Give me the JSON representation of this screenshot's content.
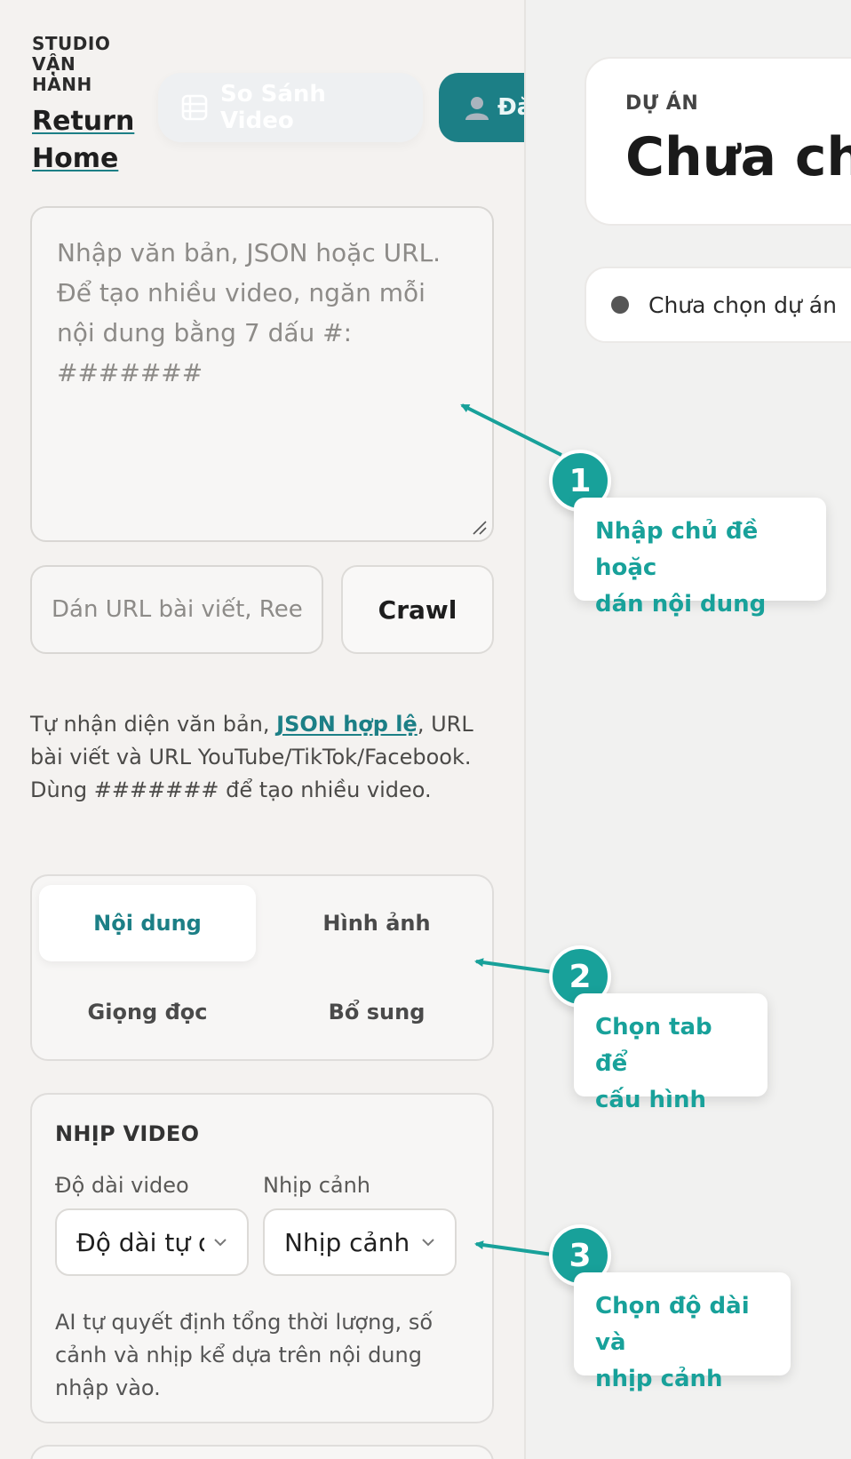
{
  "brand": {
    "title_lines": [
      "STUDIO",
      "VẬN",
      "HÀNH"
    ],
    "return_home": "Return Home"
  },
  "header": {
    "compare_label": "So Sánh Video",
    "teal_button_label": "Đă"
  },
  "input": {
    "placeholder_lines": [
      "Nhập văn bản, JSON hoặc URL.",
      "Để tạo nhiều video, ngăn mỗi",
      "nội dung bằng 7 dấu #:",
      "#######"
    ],
    "url_placeholder": "Dán URL bài viết, Ree",
    "crawl_label": "Crawl",
    "help_before": "Tự nhận diện văn bản, ",
    "help_link": "JSON hợp lệ",
    "help_after": ", URL bài viết và URL YouTube/TikTok/Facebook. Dùng ####### để tạo nhiều video."
  },
  "tabs": [
    {
      "label": "Nội dung",
      "active": true
    },
    {
      "label": "Hình ảnh",
      "active": false
    },
    {
      "label": "Giọng đọc",
      "active": false
    },
    {
      "label": "Bổ sung",
      "active": false
    }
  ],
  "rhythm": {
    "section_title": "NHỊP VIDEO",
    "length_label": "Độ dài video",
    "length_value": "Độ dài tự động",
    "pace_label": "Nhịp cảnh",
    "pace_value": "Nhịp cảnh",
    "description": "AI tự quyết định tổng thời lượng, số cảnh và nhịp kể dựa trên nội dung nhập vào."
  },
  "project": {
    "label": "DỰ ÁN",
    "name": "Chưa ch",
    "status": "Chưa chọn dự án"
  },
  "callouts": [
    {
      "number": "1",
      "text_lines": [
        "Nhập chủ đề hoặc",
        "dán nội dung"
      ]
    },
    {
      "number": "2",
      "text_lines": [
        "Chọn tab để",
        "cấu hình"
      ]
    },
    {
      "number": "3",
      "text_lines": [
        "Chọn độ dài và",
        "nhịp cảnh"
      ]
    }
  ],
  "colors": {
    "accent": "#1c7f86",
    "callout": "#18a19a",
    "background": "#f4f2f0"
  }
}
